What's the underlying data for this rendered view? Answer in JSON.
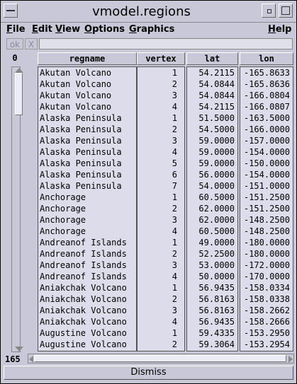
{
  "window": {
    "title": "vmodel.regions"
  },
  "menubar": {
    "items": [
      {
        "label": "File"
      },
      {
        "label": "Edit"
      },
      {
        "label": "View"
      },
      {
        "label": "Options"
      },
      {
        "label": "Graphics"
      }
    ],
    "help": "Help"
  },
  "toolbar": {
    "ok": "ok",
    "close": "X"
  },
  "table": {
    "selected_count": "0",
    "total_rows": "165",
    "columns": [
      "regname",
      "vertex",
      "lat",
      "lon"
    ],
    "rows": [
      [
        "Akutan Volcano",
        "1",
        "54.2115",
        "-165.8633"
      ],
      [
        "Akutan Volcano",
        "2",
        "54.0844",
        "-165.8636"
      ],
      [
        "Akutan Volcano",
        "3",
        "54.0844",
        "-166.0804"
      ],
      [
        "Akutan Volcano",
        "4",
        "54.2115",
        "-166.0807"
      ],
      [
        "Alaska Peninsula",
        "1",
        "51.5000",
        "-163.5000"
      ],
      [
        "Alaska Peninsula",
        "2",
        "54.5000",
        "-166.0000"
      ],
      [
        "Alaska Peninsula",
        "3",
        "59.0000",
        "-157.0000"
      ],
      [
        "Alaska Peninsula",
        "4",
        "59.0000",
        "-154.0000"
      ],
      [
        "Alaska Peninsula",
        "5",
        "59.0000",
        "-150.0000"
      ],
      [
        "Alaska Peninsula",
        "6",
        "56.0000",
        "-154.0000"
      ],
      [
        "Alaska Peninsula",
        "7",
        "54.0000",
        "-151.0000"
      ],
      [
        "Anchorage",
        "1",
        "60.5000",
        "-151.2500"
      ],
      [
        "Anchorage",
        "2",
        "62.0000",
        "-151.2500"
      ],
      [
        "Anchorage",
        "3",
        "62.0000",
        "-148.2500"
      ],
      [
        "Anchorage",
        "4",
        "60.5000",
        "-148.2500"
      ],
      [
        "Andreanof Islands",
        "1",
        "49.0000",
        "-180.0000"
      ],
      [
        "Andreanof Islands",
        "2",
        "52.2500",
        "-180.0000"
      ],
      [
        "Andreanof Islands",
        "3",
        "53.0000",
        "-172.0000"
      ],
      [
        "Andreanof Islands",
        "4",
        "50.0000",
        "-170.0000"
      ],
      [
        "Aniakchak Volcano",
        "1",
        "56.9435",
        "-158.0334"
      ],
      [
        "Aniakchak Volcano",
        "2",
        "56.8163",
        "-158.0338"
      ],
      [
        "Aniakchak Volcano",
        "3",
        "56.8163",
        "-158.2662"
      ],
      [
        "Aniakchak Volcano",
        "4",
        "56.9435",
        "-158.2666"
      ],
      [
        "Augustine Volcano",
        "1",
        "59.4335",
        "-153.2950"
      ],
      [
        "Augustine Volcano",
        "2",
        "59.3064",
        "-153.2954"
      ]
    ]
  },
  "dismiss": "Dismiss"
}
